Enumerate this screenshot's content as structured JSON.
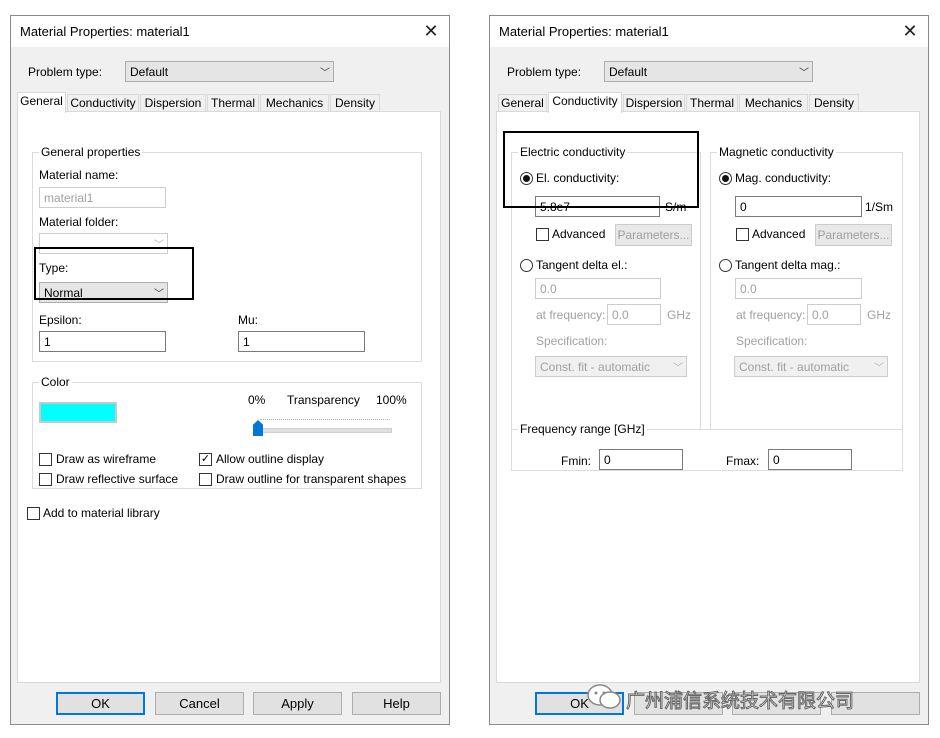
{
  "left_dialog": {
    "title": "Material Properties: material1",
    "problem_type_label": "Problem type:",
    "problem_type_value": "Default",
    "tabs": [
      "General",
      "Conductivity",
      "Dispersion",
      "Thermal",
      "Mechanics",
      "Density"
    ],
    "active_tab": "General",
    "general_group": "General properties",
    "material_name_label": "Material name:",
    "material_name_value": "material1",
    "material_folder_label": "Material folder:",
    "material_folder_value": "",
    "type_label": "Type:",
    "type_value": "Normal",
    "epsilon_label": "Epsilon:",
    "epsilon_value": "1",
    "mu_label": "Mu:",
    "mu_value": "1",
    "color_group": "Color",
    "color_swatch": "#00ffff",
    "transparency_min": "0%",
    "transparency_label": "Transparency",
    "transparency_max": "100%",
    "transparency_level": 0.0,
    "draw_wireframe": {
      "label": "Draw as wireframe",
      "checked": false
    },
    "allow_outline": {
      "label": "Allow outline display",
      "checked": true
    },
    "draw_reflective": {
      "label": "Draw reflective surface",
      "checked": false
    },
    "draw_outline_transparent": {
      "label": "Draw outline for transparent shapes",
      "checked": false
    },
    "add_library": {
      "label": "Add to material library",
      "checked": false
    },
    "buttons": {
      "ok": "OK",
      "cancel": "Cancel",
      "apply": "Apply",
      "help": "Help"
    }
  },
  "right_dialog": {
    "title": "Material Properties: material1",
    "problem_type_label": "Problem type:",
    "problem_type_value": "Default",
    "tabs": [
      "General",
      "Conductivity",
      "Dispersion",
      "Thermal",
      "Mechanics",
      "Density"
    ],
    "active_tab": "Conductivity",
    "electric_group": "Electric conductivity",
    "el_conductivity_label": "El. conductivity:",
    "el_conductivity_value": "5.8e7",
    "el_conductivity_unit": "S/m",
    "el_advanced_label": "Advanced",
    "el_parameters_label": "Parameters...",
    "tangent_el_label": "Tangent delta el.:",
    "tangent_el_value": "0.0",
    "at_frequency_label": "at frequency:",
    "at_frequency_value": "0.0",
    "freq_unit": "GHz",
    "specification_label": "Specification:",
    "specification_value": "Const. fit - automatic",
    "magnetic_group": "Magnetic conductivity",
    "mag_conductivity_label": "Mag. conductivity:",
    "mag_conductivity_value": "0",
    "mag_conductivity_unit": "1/Sm",
    "mag_advanced_label": "Advanced",
    "mag_parameters_label": "Parameters...",
    "tangent_mag_label": "Tangent delta mag.:",
    "tangent_mag_value": "0.0",
    "mag_at_frequency_label": "at frequency:",
    "mag_at_frequency_value": "0.0",
    "mag_freq_unit": "GHz",
    "mag_specification_label": "Specification:",
    "mag_specification_value": "Const. fit - automatic",
    "frequency_range_group": "Frequency range [GHz]",
    "fmin_label": "Fmin:",
    "fmin_value": "0",
    "fmax_label": "Fmax:",
    "fmax_value": "0",
    "buttons": {
      "ok": "OK"
    }
  },
  "watermark": {
    "text": "广州浦信系统技术有限公司"
  }
}
